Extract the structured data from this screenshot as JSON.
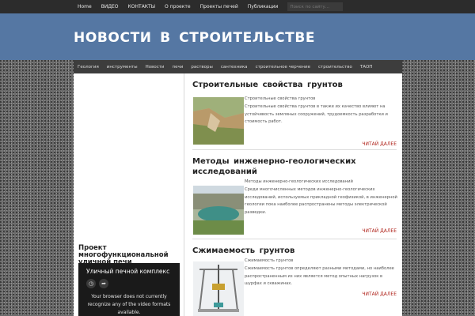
{
  "topnav": {
    "items": [
      "Home",
      "ВИДЕО",
      "КОНТАКТЫ",
      "О проекте",
      "Проекты печей",
      "Публикации"
    ],
    "search_placeholder": "Поиск по сайту..."
  },
  "header": {
    "site_title": "НОВОСТИ В СТРОИТЕЛЬСТВЕ"
  },
  "catnav": {
    "items": [
      "Геология",
      "инструменты",
      "Новости",
      "печи",
      "растворы",
      "сантехника",
      "строительное черчение",
      "строительство",
      "ТАОП"
    ]
  },
  "sidebar": {
    "widget_title": "Проект многофункциональной уличной печи",
    "video": {
      "title": "Уличный печной комплекс",
      "message": "Your browser does not currently recognize any of the video formats available."
    }
  },
  "posts": [
    {
      "title": "Строительные свойства грунтов",
      "excerpt_title": "Строительные свойства грунтов",
      "excerpt": "Строительные свойства грунтов в также их качество влияют на устойчивость земляных сооружений, трудоемкость разработки и стоимость работ.",
      "more": "ЧИТАЙ ДАЛЕЕ"
    },
    {
      "title": "Методы инженерно-геологических исследований",
      "excerpt_title": "Методы инженерно-геологических исследований",
      "excerpt": "Среди многочисленных методов инженерно-геологических исследований, используемых прикладной геофизикой, в инженерной геологии пока наиболее распространены методы электрической разведки.",
      "more": "ЧИТАЙ ДАЛЕЕ"
    },
    {
      "title": "Сжимаемость грунтов",
      "excerpt_title": "Сжимаемость грунтов",
      "excerpt": "Сжимаемость грунтов определяют разными методами, но наиболее распространенным из них является метод опытных нагрузок в шурфах и скважинах.",
      "more": "ЧИТАЙ ДАЛЕЕ"
    }
  ],
  "colors": {
    "header_bg": "#5577a3",
    "nav_bg": "#2c2c2c",
    "link_red": "#b0241c"
  }
}
